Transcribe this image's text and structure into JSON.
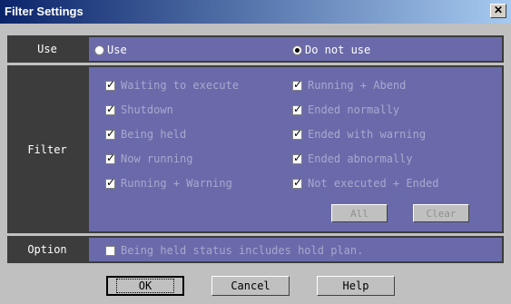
{
  "window": {
    "title": "Filter Settings",
    "close_glyph": "✕",
    "close_icon": "close-icon"
  },
  "use_row": {
    "label": "Use",
    "options": [
      {
        "label": "Use",
        "selected": false
      },
      {
        "label": "Do not use",
        "selected": true
      }
    ]
  },
  "filter_row": {
    "label": "Filter",
    "checkboxes": [
      {
        "label": "Waiting to execute",
        "checked": true
      },
      {
        "label": "Running + Abend",
        "checked": true
      },
      {
        "label": "Shutdown",
        "checked": true
      },
      {
        "label": "Ended normally",
        "checked": true
      },
      {
        "label": "Being held",
        "checked": true
      },
      {
        "label": "Ended with warning",
        "checked": true
      },
      {
        "label": "Now running",
        "checked": true
      },
      {
        "label": "Ended abnormally",
        "checked": true
      },
      {
        "label": "Running + Warning",
        "checked": true
      },
      {
        "label": "Not executed + Ended",
        "checked": true
      }
    ],
    "all_label": "All",
    "clear_label": "Clear"
  },
  "option_row": {
    "label": "Option",
    "checkbox": {
      "label": "Being held status includes hold plan.",
      "checked": false
    }
  },
  "buttons": {
    "ok": "OK",
    "cancel": "Cancel",
    "help": "Help"
  },
  "colors": {
    "title_gradient_start": "#0a246a",
    "title_gradient_end": "#a6caf0",
    "panel_label_bg": "#3c3c3c",
    "panel_content_bg": "#6a6aaa",
    "disabled_text": "#a8a8d0"
  }
}
